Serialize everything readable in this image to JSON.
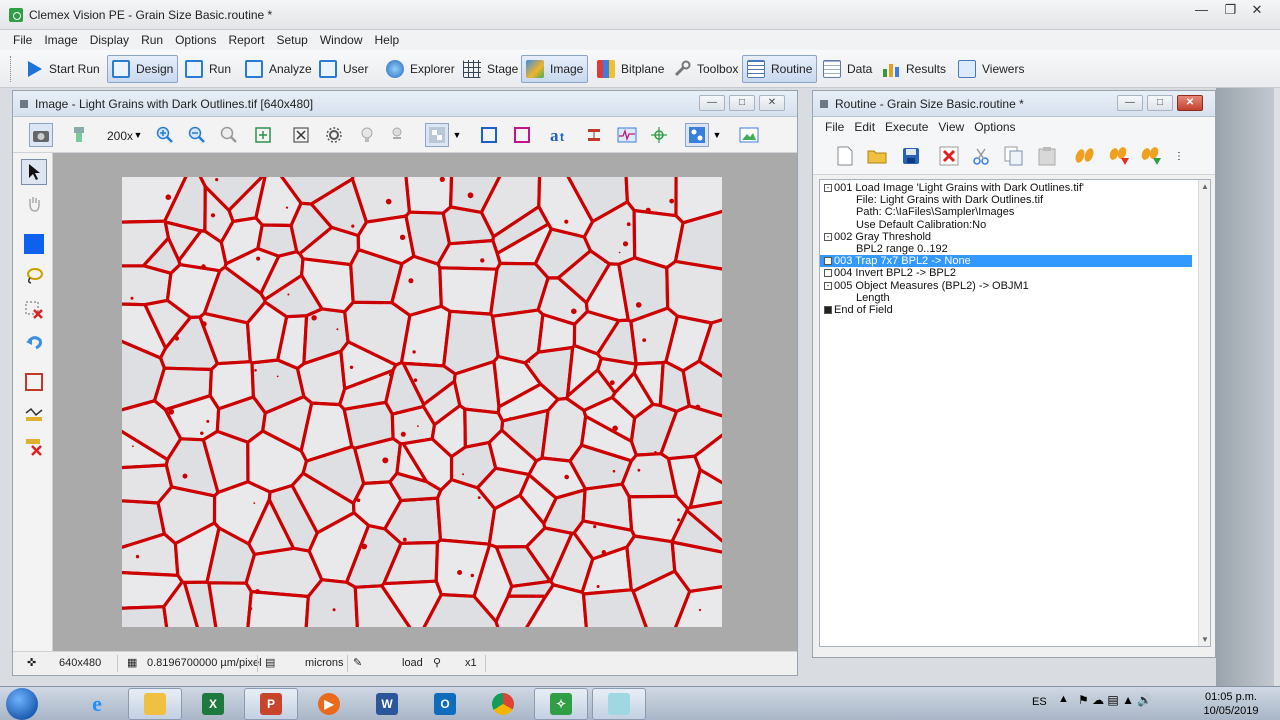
{
  "app": {
    "title": "Clemex Vision PE - Grain Size Basic.routine *"
  },
  "menu": [
    "File",
    "Image",
    "Display",
    "Run",
    "Options",
    "Report",
    "Setup",
    "Window",
    "Help"
  ],
  "toolbar": {
    "start_run": "Start Run",
    "design": "Design",
    "run": "Run",
    "analyze": "Analyze",
    "user": "User",
    "explorer": "Explorer",
    "stage": "Stage",
    "image": "Image",
    "bitplane": "Bitplane",
    "toolbox": "Toolbox",
    "routine": "Routine",
    "data": "Data",
    "results": "Results",
    "viewers": "Viewers"
  },
  "image_window": {
    "title": "Image - Light Grains with Dark Outlines.tif [640x480]",
    "zoom": "200x",
    "status": {
      "size": "640x480",
      "calibration": "0.8196700000 µm/pixel",
      "units": "microns",
      "mode": "load",
      "zoom_factor": "x1"
    }
  },
  "routine_window": {
    "title": "Routine - Grain Size Basic.routine *",
    "menu": [
      "File",
      "Edit",
      "Execute",
      "View",
      "Options"
    ],
    "lines": [
      {
        "indent": 0,
        "box": "minus",
        "text": "001  Load Image 'Light Grains with Dark Outlines.tif'"
      },
      {
        "indent": 1,
        "box": "",
        "text": "File: Light Grains with Dark Outlines.tif"
      },
      {
        "indent": 1,
        "box": "",
        "text": "Path: C:\\IaFiles\\Sampler\\Images"
      },
      {
        "indent": 1,
        "box": "",
        "text": "Use Default Calibration:No"
      },
      {
        "indent": 0,
        "box": "minus",
        "text": "002  Gray Threshold"
      },
      {
        "indent": 1,
        "box": "",
        "text": "BPL2 range 0..192"
      },
      {
        "indent": 0,
        "box": "empty",
        "text": "003  Trap 7x7  BPL2 -> None",
        "selected": true
      },
      {
        "indent": 0,
        "box": "empty",
        "text": "004  Invert BPL2 -> BPL2"
      },
      {
        "indent": 0,
        "box": "minus",
        "text": "005  Object Measures (BPL2) -> OBJM1"
      },
      {
        "indent": 1,
        "box": "",
        "text": "Length"
      },
      {
        "indent": 0,
        "box": "filled",
        "text": "End of Field"
      }
    ]
  },
  "tray": {
    "language": "ES",
    "time": "01:05 p.m.",
    "date": "10/05/2019"
  },
  "colors": {
    "grain_boundary": "#cc0000",
    "grain_fill": "#e4e4e6",
    "selection": "#3399ff"
  }
}
